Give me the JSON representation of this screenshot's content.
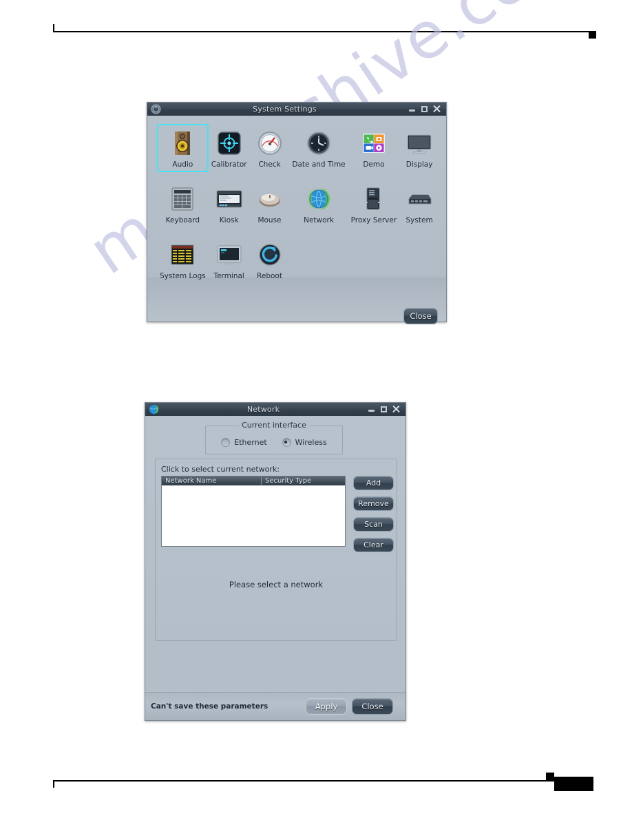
{
  "page": {
    "watermark_text": "manualshive.com"
  },
  "settings_window": {
    "title": "System Settings",
    "app_icon": "settings-gear-icon",
    "window_buttons": {
      "minimize": "minimize-icon",
      "maximize": "maximize-icon",
      "close": "close-icon"
    },
    "selected_item": "Audio",
    "items": [
      {
        "label": "Audio",
        "icon": "speaker-icon",
        "selected": true
      },
      {
        "label": "Calibrator",
        "icon": "crosshair-icon",
        "selected": false
      },
      {
        "label": "Check",
        "icon": "gauge-icon",
        "selected": false
      },
      {
        "label": "Date and Time",
        "icon": "clock-icon",
        "selected": false
      },
      {
        "label": "Demo",
        "icon": "app-tiles-icon",
        "selected": false
      },
      {
        "label": "Display",
        "icon": "monitor-icon",
        "selected": false
      },
      {
        "label": "Keyboard",
        "icon": "keyboard-icon",
        "selected": false
      },
      {
        "label": "Kiosk",
        "icon": "kiosk-screen-icon",
        "selected": false
      },
      {
        "label": "Mouse",
        "icon": "mouse-icon",
        "selected": false
      },
      {
        "label": "Network",
        "icon": "globe-icon",
        "selected": false
      },
      {
        "label": "Proxy Server",
        "icon": "server-tower-icon",
        "selected": false
      },
      {
        "label": "System",
        "icon": "thin-client-icon",
        "selected": false
      },
      {
        "label": "System Logs",
        "icon": "log-list-icon",
        "selected": false
      },
      {
        "label": "Terminal",
        "icon": "terminal-icon",
        "selected": false
      },
      {
        "label": "Reboot",
        "icon": "reboot-arrow-icon",
        "selected": false
      }
    ],
    "close_button": "Close"
  },
  "network_window": {
    "title": "Network",
    "app_icon": "globe-icon",
    "window_buttons": {
      "minimize": "minimize-icon",
      "maximize": "maximize-icon",
      "close": "close-icon"
    },
    "interface_group": {
      "title": "Current interface",
      "options": [
        {
          "label": "Ethernet",
          "checked": false
        },
        {
          "label": "Wireless",
          "checked": true
        }
      ]
    },
    "list_label": "Click to select current network:",
    "list_columns": [
      "Network Name",
      "Security Type"
    ],
    "list_rows": [],
    "side_buttons": [
      "Add",
      "Remove",
      "Scan",
      "Clear"
    ],
    "empty_message": "Please select a network",
    "status_text": "Can't save these parameters",
    "apply_button": "Apply",
    "close_button": "Close"
  }
}
